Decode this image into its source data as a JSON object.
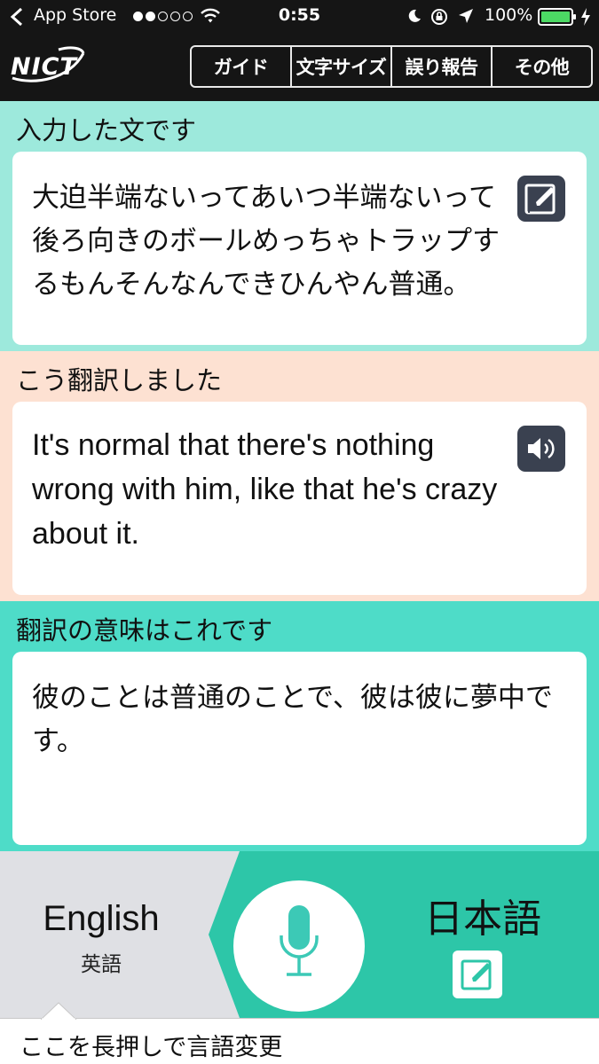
{
  "status_bar": {
    "back_app": "App Store",
    "time": "0:55",
    "battery": "100%"
  },
  "header": {
    "logo": "NICT",
    "menu": [
      {
        "label": "ガイド"
      },
      {
        "label": "文字サイズ"
      },
      {
        "label": "誤り報告"
      },
      {
        "label": "その他"
      }
    ]
  },
  "input_section": {
    "title": "入力した文です",
    "text": "大迫半端ないってあいつ半端ないって後ろ向きのボールめっちゃトラップするもんそんなんできひんやん普通。",
    "icon": "edit-icon"
  },
  "translation_section": {
    "title": "こう翻訳しました",
    "text": "It's normal that there's nothing wrong with him, like that he's crazy about it.",
    "icon": "speaker-icon"
  },
  "backtranslation_section": {
    "title": "翻訳の意味はこれです",
    "text": "彼のことは普通のことで、彼は彼に夢中です。"
  },
  "language_bar": {
    "source_lang": "English",
    "source_lang_sub": "英語",
    "target_lang": "日本語",
    "mic_icon": "microphone-icon",
    "hint": "ここを長押しで言語変更"
  },
  "colors": {
    "header_bg": "#151515",
    "input_bg": "#9de9dc",
    "translation_bg": "#fde1d2",
    "backtranslation_bg": "#4edcc8",
    "accent_teal": "#2dc6a8",
    "icon_button": "#3a4150"
  }
}
